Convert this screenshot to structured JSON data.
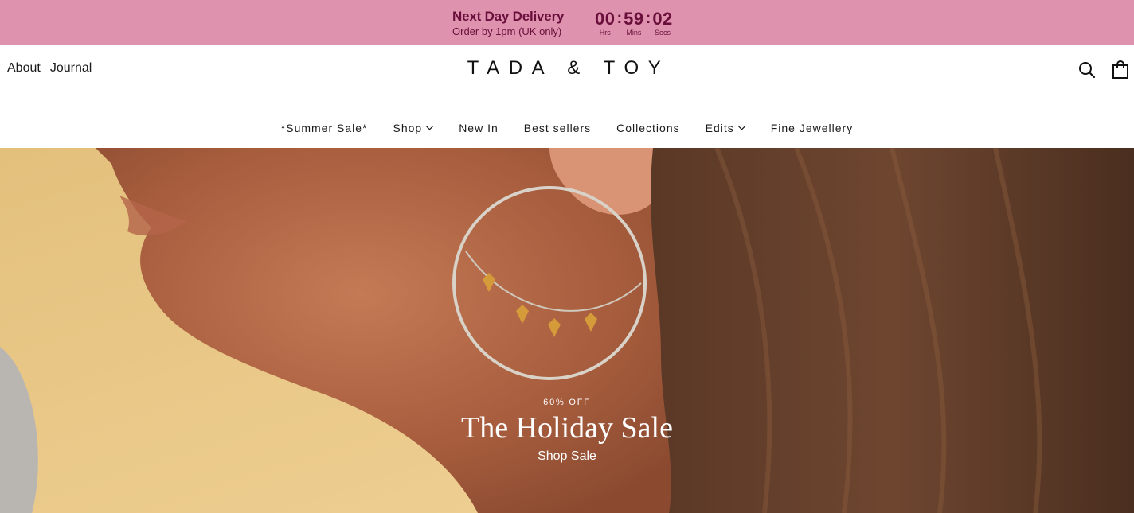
{
  "announcement": {
    "title": "Next Day Delivery",
    "subtitle": "Order by 1pm (UK only)",
    "countdown": {
      "hours": "00",
      "hours_label": "Hrs",
      "minutes": "59",
      "minutes_label": "Mins",
      "seconds": "02",
      "seconds_label": "Secs",
      "separator": ":"
    },
    "background_color": "#de92ae",
    "text_color": "#6a0f3c"
  },
  "header": {
    "utility_links": [
      "About",
      "Journal"
    ],
    "logo": "TADA & TOY",
    "icons": {
      "search": "search-icon",
      "bag": "shopping-bag-icon"
    }
  },
  "nav": {
    "items": [
      {
        "label": "*Summer Sale*",
        "dropdown": false
      },
      {
        "label": "Shop",
        "dropdown": true
      },
      {
        "label": "New In",
        "dropdown": false
      },
      {
        "label": "Best sellers",
        "dropdown": false
      },
      {
        "label": "Collections",
        "dropdown": false
      },
      {
        "label": "Edits",
        "dropdown": true
      },
      {
        "label": "Fine Jewellery",
        "dropdown": false
      }
    ]
  },
  "hero": {
    "eyebrow": "60% OFF",
    "title": "The Holiday Sale",
    "cta": "Shop Sale"
  }
}
